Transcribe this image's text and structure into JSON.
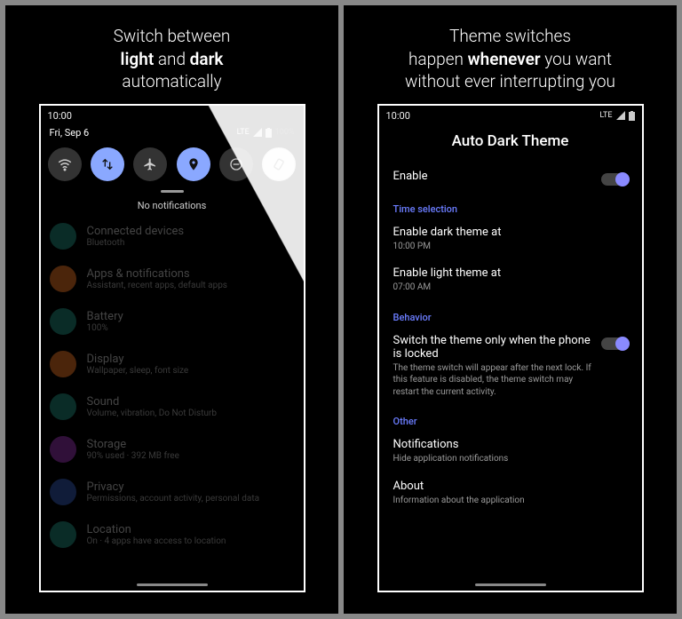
{
  "left": {
    "heading_pre": "Switch between",
    "heading_b1": "light",
    "heading_mid": " and ",
    "heading_b2": "dark",
    "heading_post": "automatically",
    "status_time": "10:00",
    "qs_date": "Fri, Sep 6",
    "qs_signal": "LTE",
    "qs_battery": "100%",
    "no_notif": "No notifications",
    "rows": [
      {
        "title": "Connected devices",
        "sub": "Bluetooth",
        "color": "#1e7d6f"
      },
      {
        "title": "Apps & notifications",
        "sub": "Assistant, recent apps, default apps",
        "color": "#d66b1f"
      },
      {
        "title": "Battery",
        "sub": "100%",
        "color": "#1e7d6f"
      },
      {
        "title": "Display",
        "sub": "Wallpaper, sleep, font size",
        "color": "#d66b1f"
      },
      {
        "title": "Sound",
        "sub": "Volume, vibration, Do Not Disturb",
        "color": "#1e7d6f"
      },
      {
        "title": "Storage",
        "sub": "90% used · 392 MB free",
        "color": "#8a2fa3"
      },
      {
        "title": "Privacy",
        "sub": "Permissions, account activity, personal data",
        "color": "#2f4fa3"
      },
      {
        "title": "Location",
        "sub": "On · 4 apps have access to location",
        "color": "#1e7d6f"
      }
    ]
  },
  "right": {
    "heading_l1": "Theme switches",
    "heading_l2a": "happen ",
    "heading_l2b": "whenever",
    "heading_l2c": " you want",
    "heading_l3": "without ever interrupting you",
    "status_time": "10:00",
    "status_signal": "LTE",
    "app_title": "Auto Dark Theme",
    "enable": "Enable",
    "sec_time": "Time selection",
    "dark_at_t": "Enable dark theme at",
    "dark_at_v": "10:00 PM",
    "light_at_t": "Enable light theme at",
    "light_at_v": "07:00 AM",
    "sec_behavior": "Behavior",
    "lock_t": "Switch the theme only when the phone is locked",
    "lock_s": "The theme switch will appear after the next lock. If this feature is disabled, the theme switch may restart the current activity.",
    "sec_other": "Other",
    "notif_t": "Notifications",
    "notif_s": "Hide application notifications",
    "about_t": "About",
    "about_s": "Information about the application"
  }
}
